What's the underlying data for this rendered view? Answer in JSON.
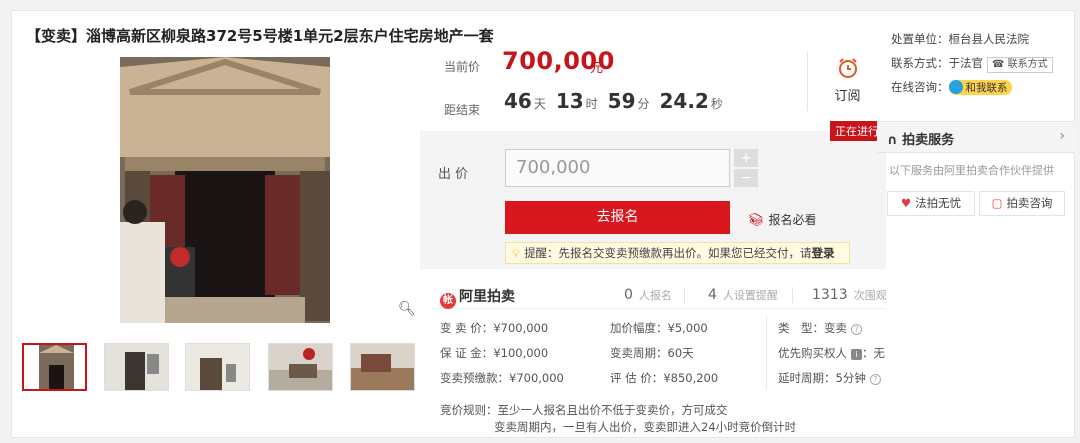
{
  "title": "【变卖】淄博高新区柳泉路372号5号楼1单元2层东户住宅房地产一套",
  "price": {
    "current_label": "当前价",
    "current_value": "700,000",
    "current_unit": "元",
    "remain_label": "距结束",
    "days": "46",
    "days_unit": "天",
    "hours": "13",
    "hours_unit": "时",
    "minutes": "59",
    "minutes_unit": "分",
    "seconds": "24.2",
    "seconds_unit": "秒",
    "subscribe_label": "订阅"
  },
  "bid": {
    "status_badge": "正在进行",
    "label": "出 价",
    "input_value": "700,000",
    "plus": "+",
    "minus": "−",
    "signup_button": "去报名",
    "must_read": "报名必看",
    "tip_text": "提醒：先报名交变卖预缴款再出价。如果您已经交付，请",
    "tip_login": "登录"
  },
  "stats": {
    "brand": "阿里拍卖",
    "applicants_count": "0",
    "applicants_label": "人报名",
    "reminders_count": "4",
    "reminders_label": "人设置提醒",
    "views_count": "1313",
    "views_label": "次围观"
  },
  "details": {
    "price_label": "变 卖 价：",
    "price_value": "¥700,000",
    "increment_label": "加价幅度：",
    "increment_value": "¥5,000",
    "type_label": "类　型：",
    "type_value": "变卖",
    "deposit_label": "保 证 金：",
    "deposit_value": "¥100,000",
    "period_label": "变卖周期：",
    "period_value": "60天",
    "priority_label": "优先购买权人",
    "priority_value": "无",
    "prepay_label": "变卖预缴款：",
    "prepay_value": "¥700,000",
    "valuation_label": "评 估 价：",
    "valuation_value": "¥850,200",
    "delay_label": "延时周期：",
    "delay_value": "5分钟",
    "rule_label": "竞价规则：",
    "rule_line1": "至少一人报名且出价不低于变卖价，方可成交",
    "rule_line2": "变卖周期内，一旦有人出价，变卖即进入24小时竞价倒计时"
  },
  "side": {
    "court_label": "处置单位：",
    "court_value": "桓台县人民法院",
    "contact_label": "联系方式：",
    "contact_value": "于法官",
    "contact_button": "联系方式",
    "consult_label": "在线咨询：",
    "consult_button": "和我联系",
    "service_title": "拍卖服务",
    "service_desc": "以下服务由阿里拍卖合作伙伴提供",
    "service_btn1": "法拍无忧",
    "service_btn2": "拍卖咨询"
  },
  "colors": {
    "accent_red": "#c7141a",
    "button_red": "#d9171e",
    "tip_bg": "#fffbe0"
  }
}
